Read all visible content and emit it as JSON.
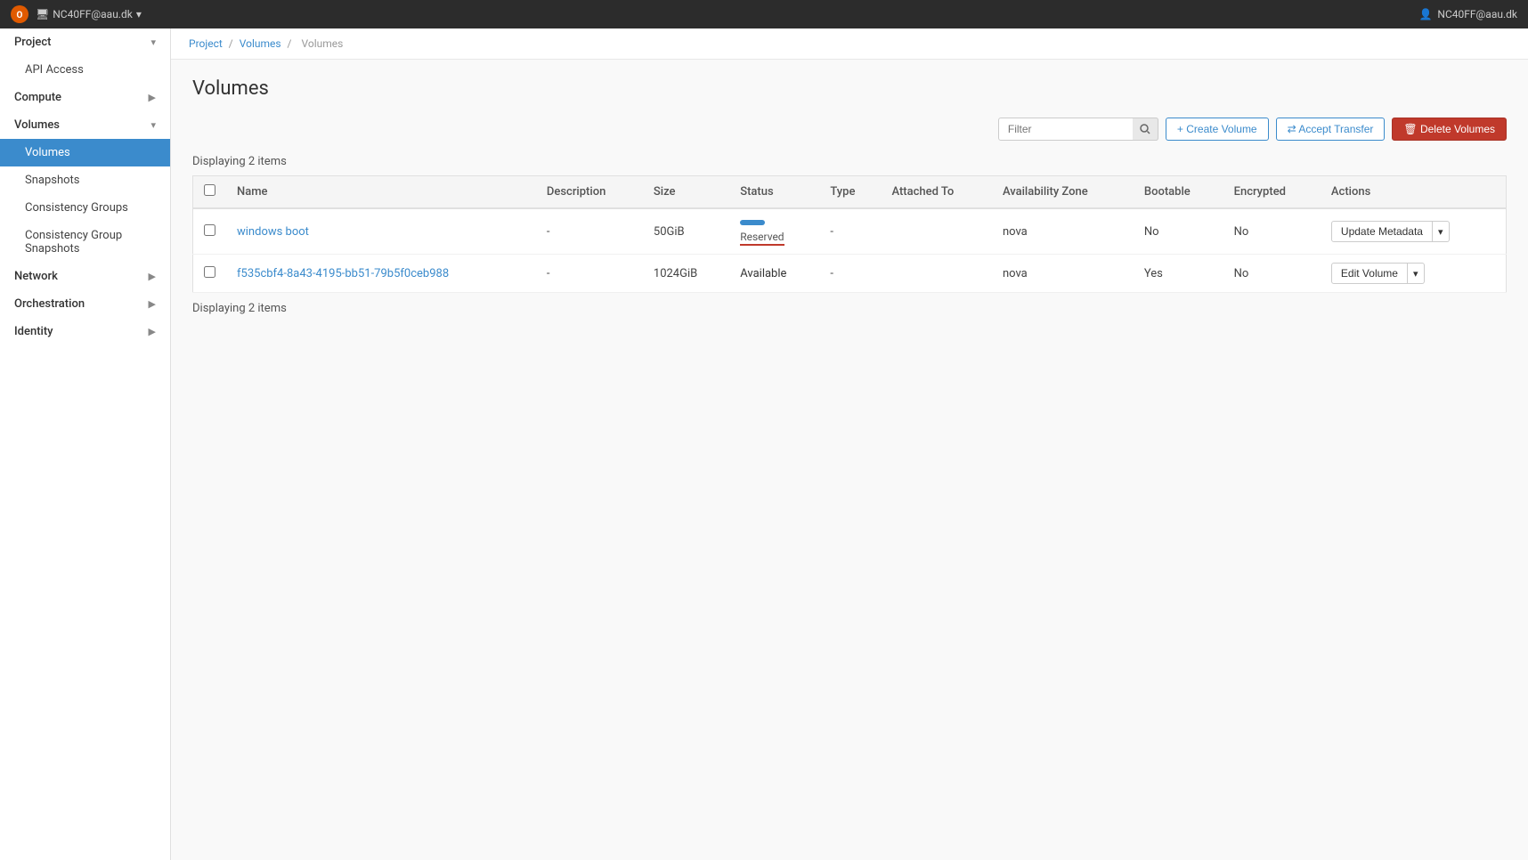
{
  "topbar": {
    "logo_text": "O",
    "project_label": "NC40FF@aau.dk",
    "project_dropdown": "▾",
    "user_icon": "👤",
    "user_label": "NC40FF@aau.dk"
  },
  "sidebar": {
    "sections": [
      {
        "id": "project",
        "label": "Project",
        "expanded": true,
        "chevron": "▾"
      },
      {
        "id": "api-access",
        "label": "API Access",
        "sub": true
      },
      {
        "id": "compute",
        "label": "Compute",
        "chevron": "▶"
      },
      {
        "id": "volumes",
        "label": "Volumes",
        "chevron": "▾"
      },
      {
        "id": "volumes-sub",
        "label": "Volumes",
        "sub": true,
        "active": true
      },
      {
        "id": "snapshots",
        "label": "Snapshots",
        "sub": true
      },
      {
        "id": "consistency-groups",
        "label": "Consistency Groups",
        "sub": true
      },
      {
        "id": "consistency-group-snapshots",
        "label": "Consistency Group Snapshots",
        "sub": true
      },
      {
        "id": "network",
        "label": "Network",
        "chevron": "▶"
      },
      {
        "id": "orchestration",
        "label": "Orchestration",
        "chevron": "▶"
      },
      {
        "id": "identity",
        "label": "Identity",
        "chevron": "▶"
      }
    ]
  },
  "breadcrumb": {
    "items": [
      "Project",
      "Volumes",
      "Volumes"
    ],
    "separator": "/"
  },
  "page": {
    "title": "Volumes"
  },
  "toolbar": {
    "filter_placeholder": "Filter",
    "search_icon": "🔍",
    "create_volume_label": "+ Create Volume",
    "accept_transfer_label": "⇄ Accept Transfer",
    "delete_volumes_label": "🗑 Delete Volumes"
  },
  "table": {
    "displaying_text": "Displaying 2 items",
    "columns": [
      "",
      "Name",
      "Description",
      "Size",
      "Status",
      "Type",
      "Attached To",
      "Availability Zone",
      "Bootable",
      "Encrypted",
      "Actions"
    ],
    "rows": [
      {
        "id": "row1",
        "name": "windows boot",
        "description": "-",
        "size": "50GiB",
        "status_badge": "Reserved",
        "type": "-",
        "attached_to": "",
        "availability_zone": "nova",
        "bootable": "No",
        "encrypted": "No",
        "action": "Update Metadata"
      },
      {
        "id": "row2",
        "name": "f535cbf4-8a43-4195-bb51-79b5f0ceb988",
        "description": "-",
        "size": "1024GiB",
        "status_text": "Available",
        "type": "-",
        "attached_to": "",
        "availability_zone": "nova",
        "bootable": "Yes",
        "encrypted": "No",
        "action": "Edit Volume"
      }
    ],
    "displaying_text_bottom": "Displaying 2 items"
  }
}
